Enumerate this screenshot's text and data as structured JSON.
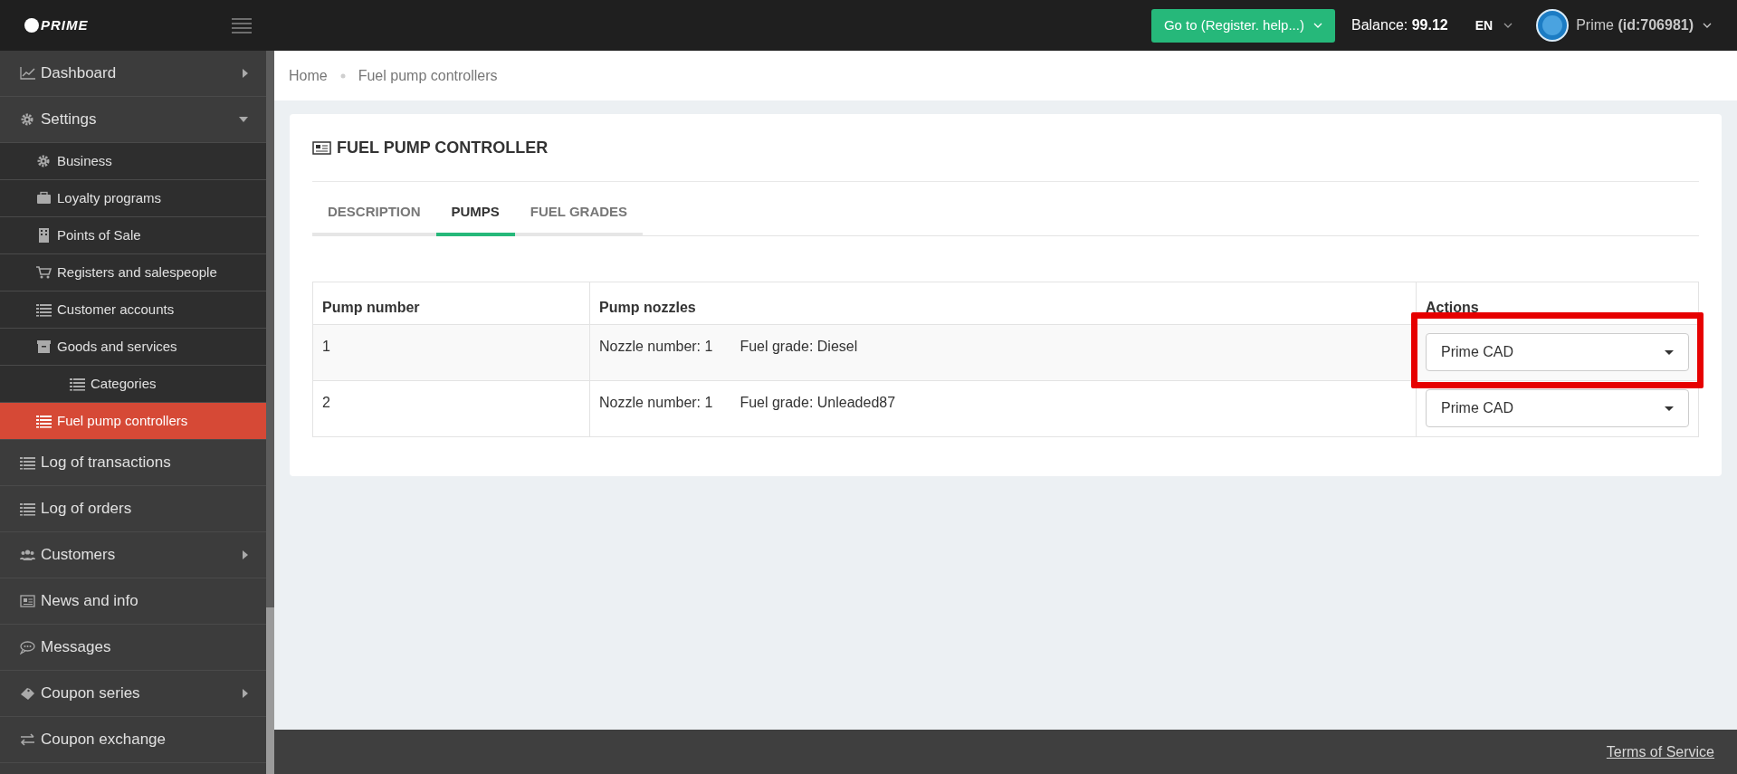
{
  "header": {
    "logo": "PRIME",
    "goto_button": "Go to (Register. help...)",
    "balance": "Balance: **99.12**",
    "language": "EN",
    "user": "Prime **(id:706981)**"
  },
  "sidebar": {
    "items": [
      {
        "label": "Dashboard",
        "expanded": false,
        "selected": false
      },
      {
        "label": "Settings",
        "expanded": true,
        "selected": false,
        "children": [
          {
            "label": "Business",
            "selected": false
          },
          {
            "label": "Loyalty programs",
            "selected": false
          },
          {
            "label": "Points of Sale",
            "selected": false
          },
          {
            "label": "Registers and salespeople",
            "selected": false
          },
          {
            "label": "Customer accounts",
            "selected": false
          },
          {
            "label": "Goods and services",
            "selected": false,
            "children": [
              {
                "label": "Categories",
                "selected": false
              }
            ]
          },
          {
            "label": "Fuel pump controllers",
            "selected": true
          }
        ]
      },
      {
        "label": "Log of transactions",
        "selected": false
      },
      {
        "label": "Log of orders",
        "selected": false
      },
      {
        "label": "Customers",
        "expanded": false,
        "selected": false
      },
      {
        "label": "News and info",
        "selected": false
      },
      {
        "label": "Messages",
        "selected": false
      },
      {
        "label": "Coupon series",
        "expanded": false,
        "selected": false
      },
      {
        "label": "Coupon exchange",
        "selected": false
      }
    ]
  },
  "breadcrumb": [
    "Home",
    "Fuel pump controllers"
  ],
  "card": {
    "title": "FUEL PUMP CONTROLLER",
    "tabs": [
      {
        "label": "DESCRIPTION",
        "selected": false
      },
      {
        "label": "PUMPS",
        "selected": true
      },
      {
        "label": "FUEL GRADES",
        "selected": false
      }
    ],
    "table": {
      "columns": [
        "Pump number",
        "Pump nozzles",
        "Actions"
      ],
      "rows": [
        {
          "pump_number": "1",
          "nozzles": [
            {
              "number": "Nozzle number: 1",
              "grade": "Fuel grade: Diesel"
            }
          ],
          "action": "Prime CAD",
          "highlighted": true
        },
        {
          "pump_number": "2",
          "nozzles": [
            {
              "number": "Nozzle number: 1",
              "grade": "Fuel grade: Unleaded87"
            }
          ],
          "action": "Prime CAD",
          "highlighted": false
        }
      ]
    }
  },
  "footer": {
    "link": "Terms of Service"
  }
}
